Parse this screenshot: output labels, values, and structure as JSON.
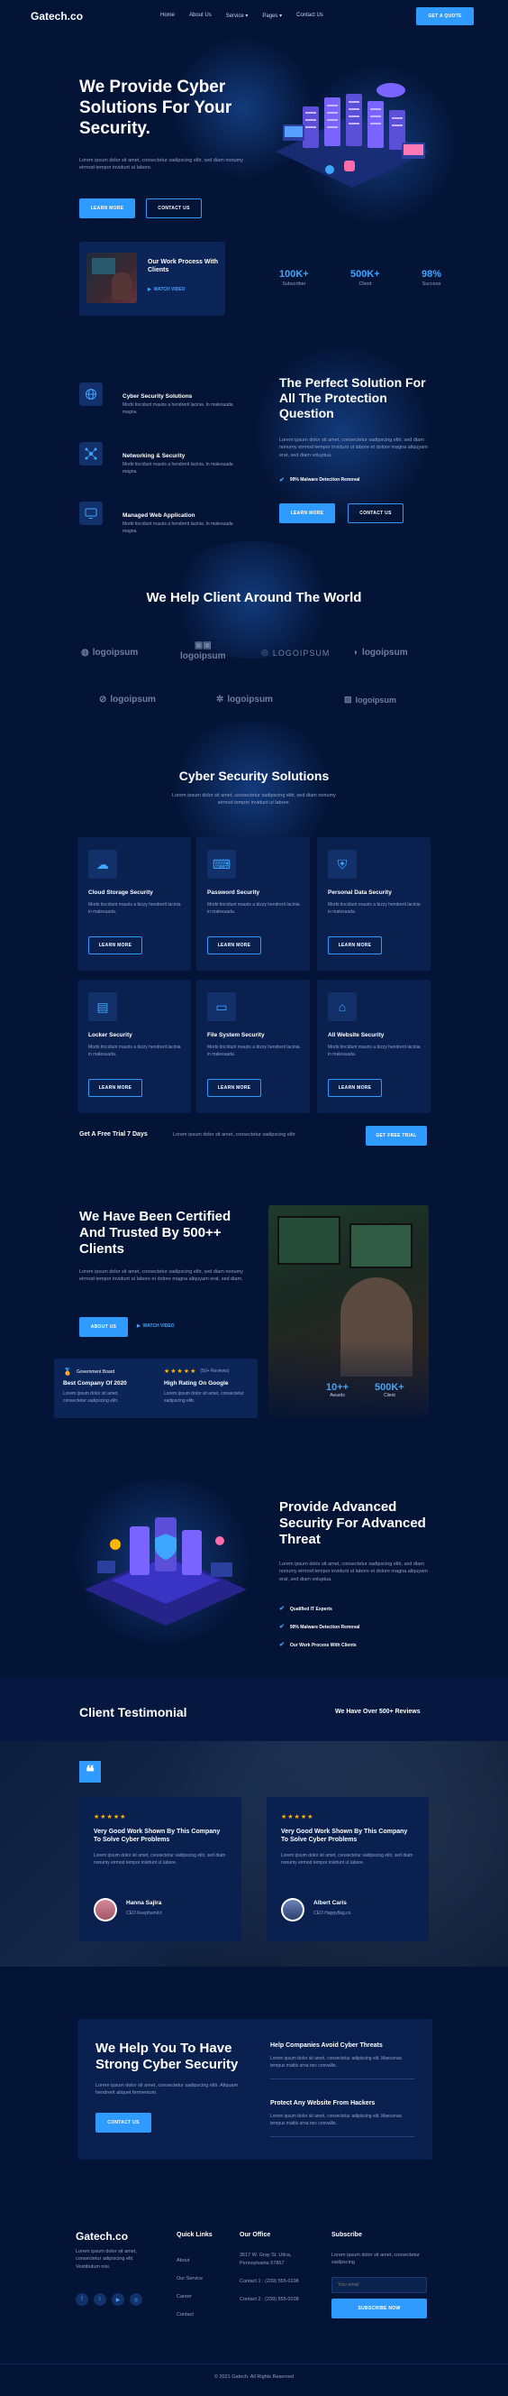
{
  "header": {
    "logo": "Gatech.co",
    "nav": [
      "Home",
      "About Us",
      "Service",
      "Pages",
      "Contact Us"
    ],
    "cta": "GET A QUOTE"
  },
  "hero": {
    "title": "We Provide Cyber Solutions For Your Security.",
    "text": "Lorem ipsum dolor sit amet, consectetur sadipscing elitr, sed diam nonumy eirmod tempor invidunt ut labore.",
    "btn_primary": "LEARN MORE",
    "btn_secondary": "CONTACT US",
    "video_title": "Our Work Process With Clients",
    "video_link": "WATCH VIDEO",
    "stats": [
      {
        "value": "100K+",
        "label": "Subscriber"
      },
      {
        "value": "500K+",
        "label": "Client"
      },
      {
        "value": "98%",
        "label": "Success"
      }
    ]
  },
  "solution": {
    "items": [
      {
        "title": "Cyber Security Solutions",
        "text": "Morbi tincidunt mauris a hendrerit lacinia. In malesuada magna."
      },
      {
        "title": "Networking & Security",
        "text": "Morbi tincidunt mauris a hendrerit lacinia. In malesuada magna."
      },
      {
        "title": "Managed Web Application",
        "text": "Morbi tincidunt mauris a hendrerit lacinia. In malesuada magna."
      }
    ],
    "title": "The Perfect Solution For All The Protection Question",
    "text": "Lorem ipsum dolor sit amet, consectetur sadipscing elitr, sed diam nonumy eirmod tempor invidunt ut labore et dolore magna aliquyam erat, sed diam voluptua.",
    "check": "99% Malware Detection Removal",
    "btn_primary": "LEARN MORE",
    "btn_secondary": "CONTACT US"
  },
  "clients": {
    "title": "We Help Client Around The World",
    "logos": [
      "logoipsum",
      "logoipsum",
      "LOGOIPSUM",
      "logoipsum",
      "logoipsum",
      "logoipsum",
      "logoipsum"
    ]
  },
  "services": {
    "title": "Cyber Security Solutions",
    "text": "Lorem ipsum dolor sit amet, consectetur sadipscing elitr, sed diam nonumy eirmod tempor invidunt ut labore.",
    "cards": [
      {
        "title": "Cloud Storage Security",
        "text": "Morbi tincidunt mauris a bizzy hendrerit lacinia in malesuada.",
        "btn": "LEARN MORE"
      },
      {
        "title": "Password Security",
        "text": "Morbi tincidunt mauris a bizzy hendrerit lacinia in malesuada.",
        "btn": "LEARN MORE"
      },
      {
        "title": "Personal Data Security",
        "text": "Morbi tincidunt mauris a bizzy hendrerit lacinia in malesuada.",
        "btn": "LEARN MORE"
      },
      {
        "title": "Locker Security",
        "text": "Morbi tincidunt mauris a bizzy hendrerit lacinia in malesuada.",
        "btn": "LEARN MORE"
      },
      {
        "title": "File System Security",
        "text": "Morbi tincidunt mauris a bizzy hendrerit lacinia in malesuada.",
        "btn": "LEARN MORE"
      },
      {
        "title": "All Website Security",
        "text": "Morbi tincidunt mauris a bizzy hendrerit lacinia in malesuada.",
        "btn": "LEARN MORE"
      }
    ],
    "trial_title": "Get A Free Trial 7 Days",
    "trial_text": "Lorem ipsum dolor sit amet, consectetur sadipscing elitr",
    "trial_btn": "GET FREE TRIAL"
  },
  "certified": {
    "title": "We Have Been Certified And Trusted By 500++ Clients",
    "text": "Lorem ipsum dolor sit amet, consectetur sadipscing elitr, sed diam nonumy eirmod tempor invidunt ut labore et dolore magna aliquyam erat, sed diam.",
    "btn": "ABOUT US",
    "video": "WATCH VIDEO",
    "badge_label": "Government Board",
    "badge_title": "Best Company Of 2020",
    "badge_text": "Lorem ipsum dolor sit amet, consectetur sadipscing elitr.",
    "stars": "★★★★★",
    "reviews": "(50+ Reviews)",
    "rating_title": "High Rating On Google",
    "rating_text": "Lorem ipsum dolor sit amet, consectetur sadipscing elitr.",
    "stats": [
      {
        "value": "10++",
        "label": "Awards"
      },
      {
        "value": "500K+",
        "label": "Client"
      }
    ]
  },
  "advanced": {
    "title": "Provide Advanced Security For Advanced Threat",
    "text": "Lorem ipsum dolor sit amet, consectetur sadipscing elitr, sed diam nonumy eirmod tempor invidunt ut labore et dolore magna aliquyam erat, sed diam voluptua.",
    "checks": [
      "Qualified IT Experts",
      "99% Malware Detection Removal",
      "Our Work Process With Clients"
    ]
  },
  "testimonials": {
    "title": "Client Testimonial",
    "reviews": "We Have Over 500+ Reviews",
    "items": [
      {
        "stars": "★★★★★",
        "title": "Very Good Work Shown By This Company To Solve Cyber Problems",
        "text": "Lorem ipsum dolor sit amet, consectetur sadipscing elitr, sed diam nonumy eirmod tempor invidunt ut labore.",
        "name": "Hanna Sajira",
        "role": "CEO Keephumil.it"
      },
      {
        "stars": "★★★★★",
        "title": "Very Good Work Shown By This Company To Solve Cyber Problems",
        "text": "Lorem ipsum dolor sit amet, consectetur sadipscing elitr, sed diam nonumy eirmod tempor invidunt ut labore.",
        "name": "Albert Caris",
        "role": "CEO Happyflag.co"
      }
    ]
  },
  "cta": {
    "title": "We Help You To Have Strong Cyber Security",
    "text": "Lorem ipsum dolor sit amet, consectetur sadipscing elitr. Aliquam hendrerit aliquet fermentum.",
    "btn": "CONTACT US",
    "items": [
      {
        "title": "Help Companies Avoid Cyber Threats",
        "text": "Lorem ipsum dolor sit amet, consectetur adipiscing elit. Maecenas tempus mattis urna nec convallis."
      },
      {
        "title": "Protect Any Website From Hackers",
        "text": "Lorem ipsum dolor sit amet, consectetur adipiscing elit. Maecenas tempus mattis urna nec convallis."
      }
    ]
  },
  "footer": {
    "logo": "Gatech.co",
    "about": "Lorem ipsum dolor sit amet, consectetur adipiscing elit. Vestibulum nisi.",
    "links_title": "Quick Links",
    "links": [
      "About",
      "Our Service",
      "Career",
      "Contact"
    ],
    "office_title": "Our Office",
    "address": "3517 W. Gray St. Utica, Pennsylvania 57867",
    "contact1": "Contact 1 : (239) 555-0108",
    "contact2": "Contact 2 : (239) 555-0108",
    "subscribe_title": "Subscribe",
    "subscribe_text": "Lorem ipsum dolor sit amet, consectetur sadipscing",
    "email_placeholder": "Your email",
    "subscribe_btn": "SUBSCRIBE NOW",
    "copyright": "© 2021 Gatech. All Rights Reserved"
  }
}
